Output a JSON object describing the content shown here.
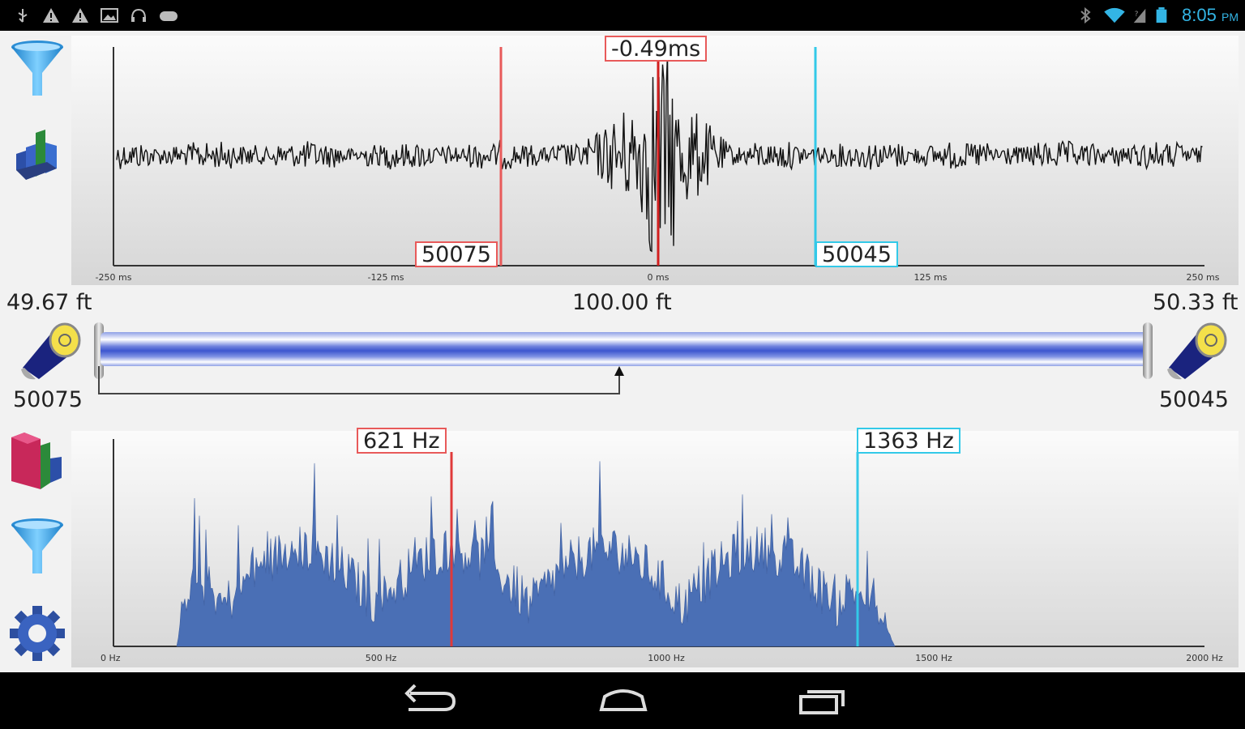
{
  "status_bar": {
    "left_icons": [
      "usb-icon",
      "warning-icon",
      "warning-icon",
      "image-icon",
      "headset-icon",
      "gamepad-icon"
    ],
    "right_icons": [
      "bluetooth-icon",
      "wifi-icon",
      "signal-icon",
      "battery-icon"
    ],
    "time": "8:05",
    "ampm": "PM",
    "accent_color": "#33b5e5"
  },
  "time_plot": {
    "delay_label": "-0.49ms",
    "left_cursor_label": "50075",
    "right_cursor_label": "50045",
    "x_ticks": [
      "-250 ms",
      "-125 ms",
      "0 ms",
      "125 ms",
      "250 ms"
    ],
    "left_cursor_color": "#e85a5a",
    "right_cursor_color": "#33c9e8"
  },
  "pipe": {
    "left_distance": "49.67 ft",
    "total_length": "100.00 ft",
    "right_distance": "50.33 ft",
    "left_sensor_id": "50075",
    "right_sensor_id": "50045"
  },
  "freq_plot": {
    "left_cursor_label": "621 Hz",
    "right_cursor_label": "1363 Hz",
    "x_ticks": [
      "0 Hz",
      "500 Hz",
      "1000 Hz",
      "1500 Hz",
      "2000 Hz"
    ],
    "bar_color": "#4a6fb5"
  },
  "nav_bar": {
    "icons": [
      "back-icon",
      "home-icon",
      "recent-apps-icon"
    ]
  }
}
